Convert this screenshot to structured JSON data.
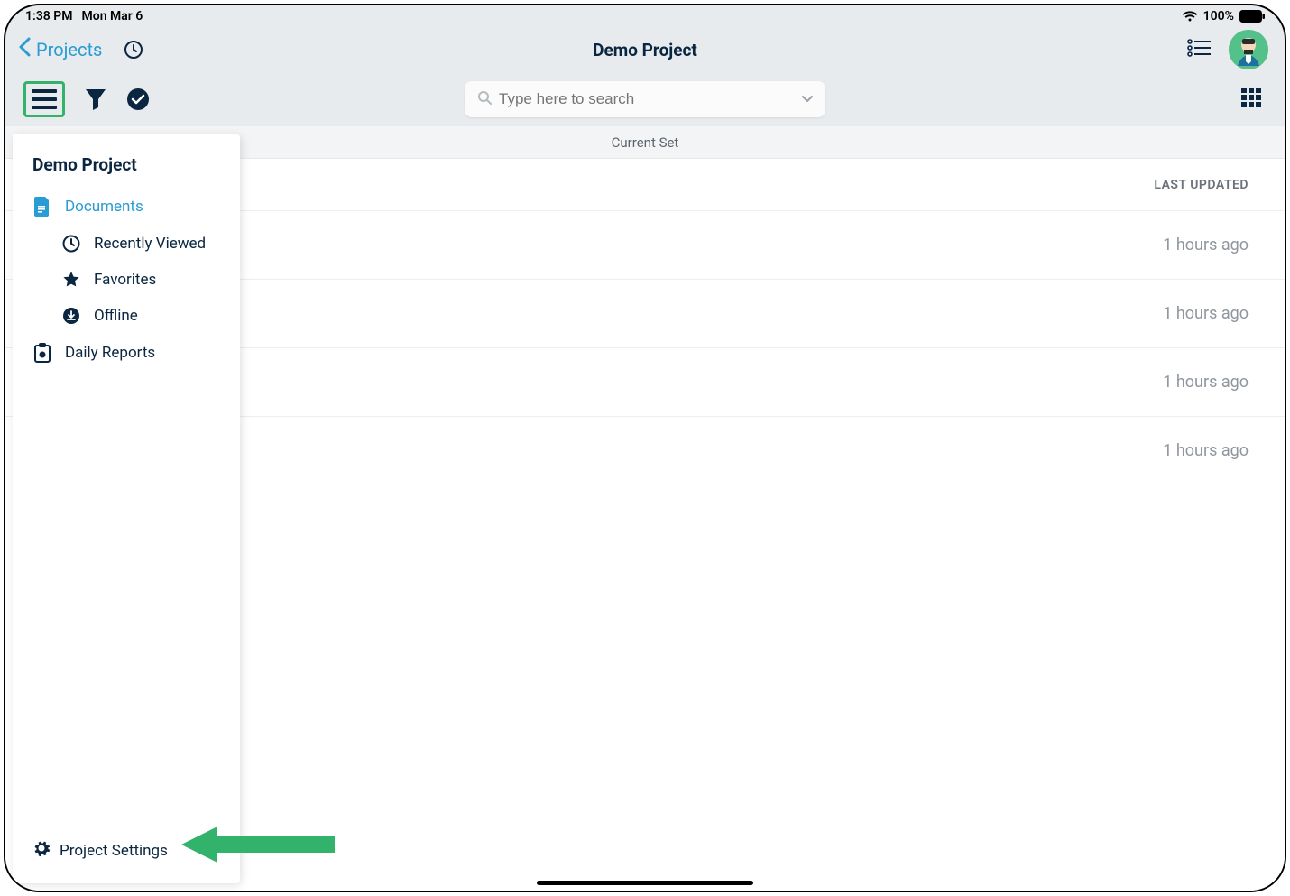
{
  "status": {
    "time": "1:38 PM",
    "date": "Mon Mar 6",
    "battery": "100%"
  },
  "nav": {
    "back_label": "Projects",
    "title": "Demo Project"
  },
  "search": {
    "placeholder": "Type here to search"
  },
  "section": {
    "label": "Current Set"
  },
  "list": {
    "header": "LAST UPDATED",
    "rows": [
      {
        "updated": "1 hours ago"
      },
      {
        "updated": "1 hours ago"
      },
      {
        "updated": "1 hours ago"
      },
      {
        "updated": "1 hours ago"
      }
    ]
  },
  "drawer": {
    "title": "Demo Project",
    "items": {
      "documents": "Documents",
      "recently_viewed": "Recently Viewed",
      "favorites": "Favorites",
      "offline": "Offline",
      "daily_reports": "Daily Reports"
    },
    "settings": "Project Settings"
  }
}
